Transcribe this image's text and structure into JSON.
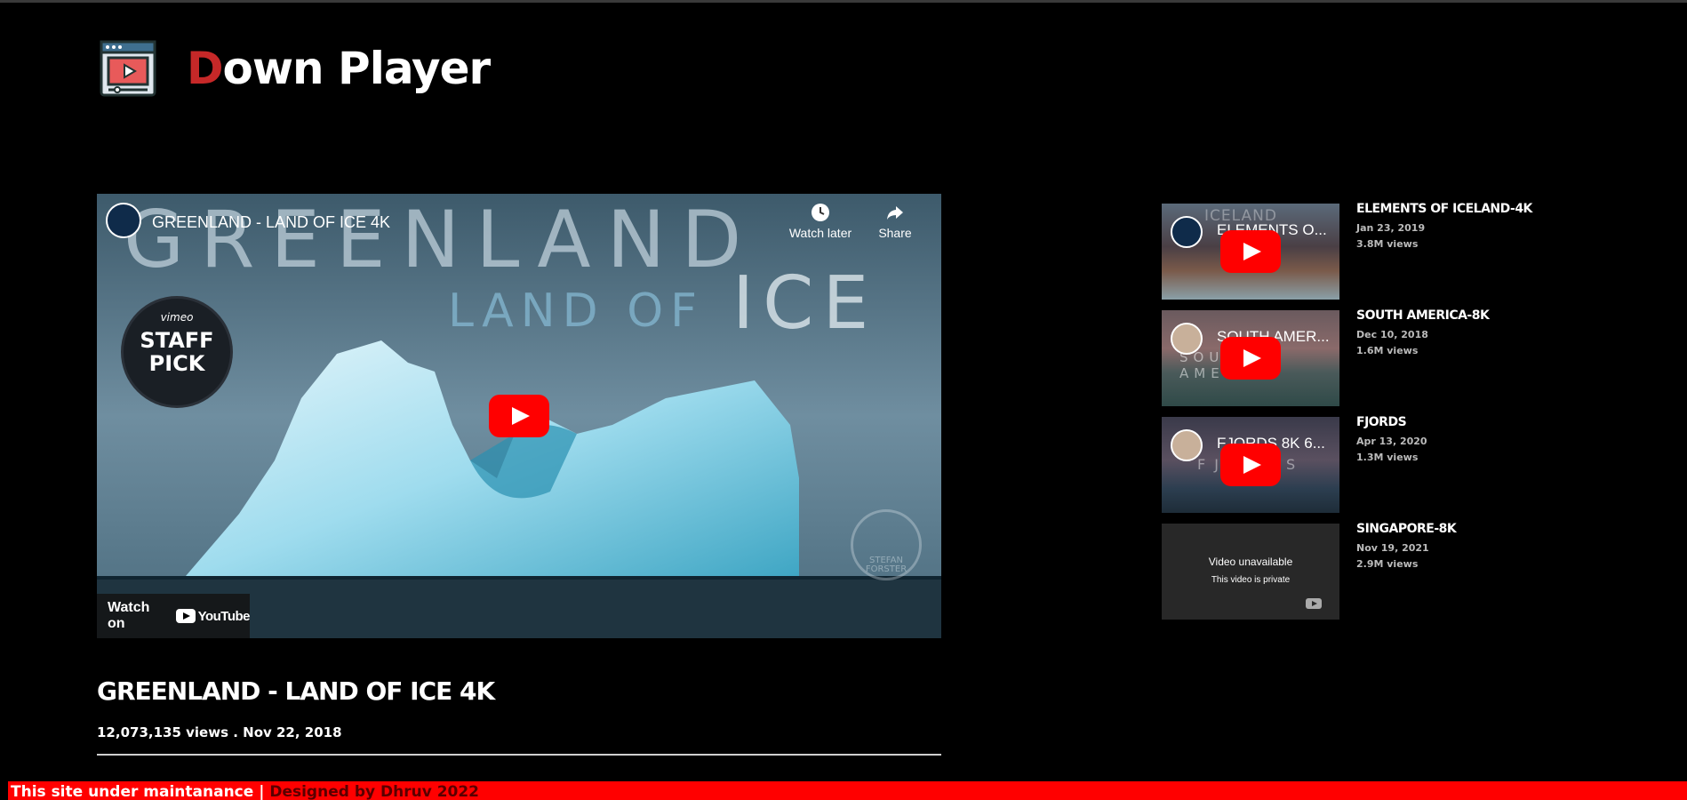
{
  "brand": {
    "title_first": "D",
    "title_rest": "own Player"
  },
  "main_video": {
    "overlay_title": "GREENLAND - LAND OF ICE 4K",
    "watch_later": "Watch later",
    "share": "Share",
    "banner_line1": "GREENLAND",
    "banner_line2": "LAND OF",
    "banner_line3": "ICE",
    "badge_top": "vimeo",
    "badge_line1": "STAFF",
    "badge_line2": "PICK",
    "watermark_text": "STEFAN FORSTER",
    "watch_on": "Watch on",
    "youtube": "YouTube",
    "title": "GREENLAND - LAND OF ICE 4K",
    "meta": "12,073,135 views . Nov 22, 2018"
  },
  "sidebar": {
    "items": [
      {
        "thumb_title": "ELEMENTS O...",
        "title": "ELEMENTS OF ICELAND-4K",
        "date": "Jan 23, 2019",
        "views": "3.8M views",
        "thumb_top_text": "ICELAND"
      },
      {
        "thumb_title": "SOUTH AMER...",
        "title": "SOUTH AMERICA-8K",
        "date": "Dec 10, 2018",
        "views": "1.6M views",
        "thumb_top_text": "SOUTH AMERICA"
      },
      {
        "thumb_title": "FJORDS 8K 6...",
        "title": "FJORDS",
        "date": "Apr 13, 2020",
        "views": "1.3M views",
        "thumb_top_text": "FJORDS"
      },
      {
        "unavailable_title": "Video unavailable",
        "unavailable_sub": "This video is private",
        "title": "SINGAPORE-8K",
        "date": "Nov 19, 2021",
        "views": "2.9M views"
      }
    ]
  },
  "footer": {
    "main": "This site under maintanance",
    "separator": " | ",
    "credit": "Designed by Dhruv 2022"
  },
  "colors": {
    "accent_red": "#ff0000",
    "brand_red": "#c62828",
    "background": "#000000"
  },
  "icons": {
    "brand": "video-player-icon",
    "watch_later": "clock-icon",
    "share": "share-icon",
    "play": "youtube-play-icon"
  }
}
